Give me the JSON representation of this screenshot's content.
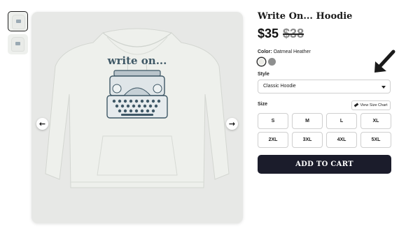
{
  "product": {
    "title": "Write On... Hoodie",
    "price": "$35",
    "old_price": "$38",
    "graphic_text": "write on..."
  },
  "gallery": {
    "thumbnail_count": 2,
    "prev_icon": "chevron-left-icon",
    "next_icon": "chevron-right-icon"
  },
  "color": {
    "label": "Color:",
    "selected": "Oatmeal Heather",
    "swatches": [
      {
        "name": "Oatmeal Heather",
        "hex": "#ecece7",
        "selected": true
      },
      {
        "name": "Grey",
        "hex": "#8e8f8f",
        "selected": false
      }
    ]
  },
  "style": {
    "label": "Style",
    "selected": "Classic Hoodie"
  },
  "size": {
    "label": "Size",
    "chart_button": "View Size Chart",
    "options": [
      "S",
      "M",
      "L",
      "XL",
      "2XL",
      "3XL",
      "4XL",
      "5XL"
    ]
  },
  "cart": {
    "add_label": "ADD TO CART"
  },
  "colors": {
    "button_dark": "#1b1c2b",
    "image_bg": "#e7e8e6",
    "ink": "#3f5866"
  }
}
